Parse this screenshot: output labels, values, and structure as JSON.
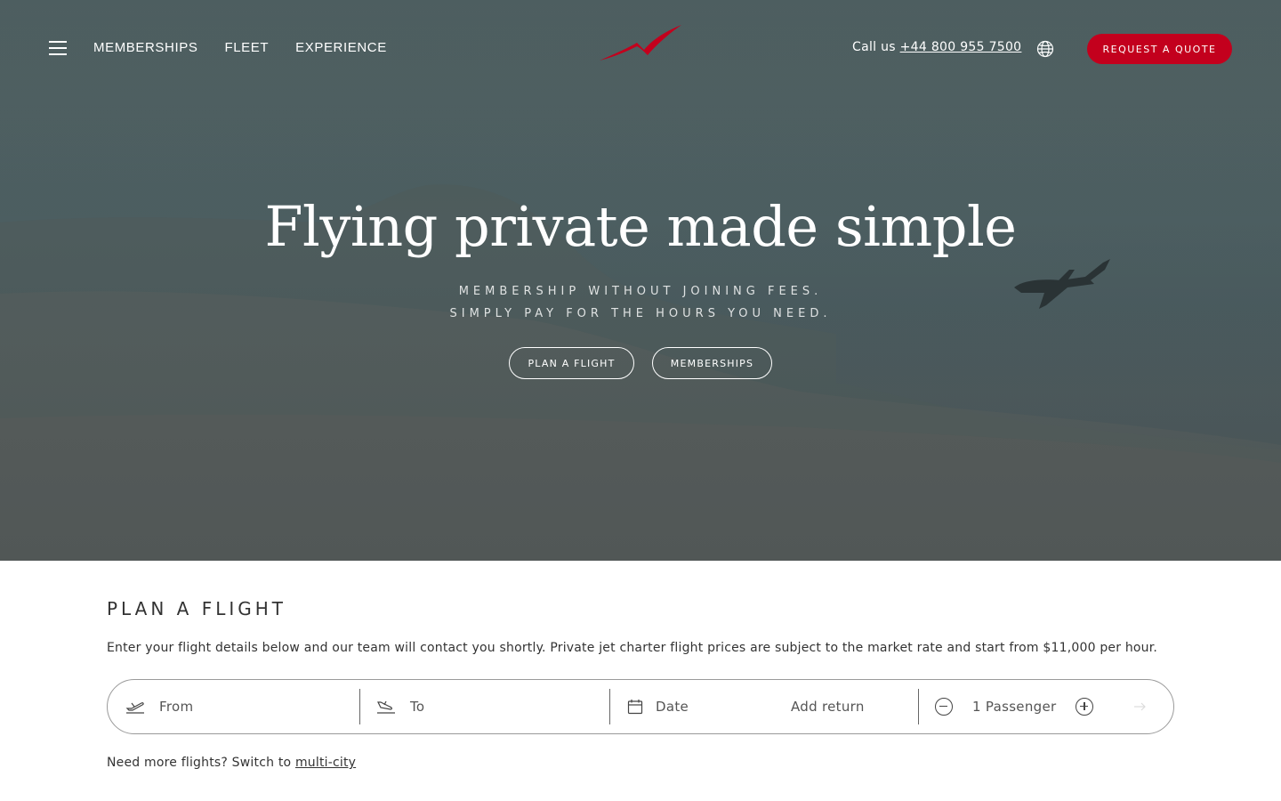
{
  "nav": {
    "menu_icon": "hamburger-menu-icon",
    "links": [
      "MEMBERSHIPS",
      "FLEET",
      "EXPERIENCE"
    ],
    "call_prefix": "Call us",
    "phone": "+44 800 955 7500",
    "globe_icon": "globe-icon",
    "quote_label": "REQUEST A QUOTE"
  },
  "hero": {
    "title": "Flying private made simple",
    "subtitle_line1": "MEMBERSHIP WITHOUT JOINING FEES.",
    "subtitle_line2": "SIMPLY PAY FOR THE HOURS YOU NEED.",
    "btn_plan": "PLAN A FLIGHT",
    "btn_memberships": "MEMBERSHIPS"
  },
  "plan": {
    "title": "PLAN A FLIGHT",
    "description": "Enter your flight details below and our team will contact you shortly. Private jet charter flight prices are subject to the market rate and start from $11,000 per hour.",
    "from_placeholder": "From",
    "to_placeholder": "To",
    "date_placeholder": "Date",
    "add_return": "Add return",
    "passengers": "1 Passenger",
    "multi_prefix": "Need more flights? Switch to",
    "multi_link": "multi-city"
  },
  "colors": {
    "brand_red": "#c3001d",
    "hero_bg": "#526365"
  }
}
